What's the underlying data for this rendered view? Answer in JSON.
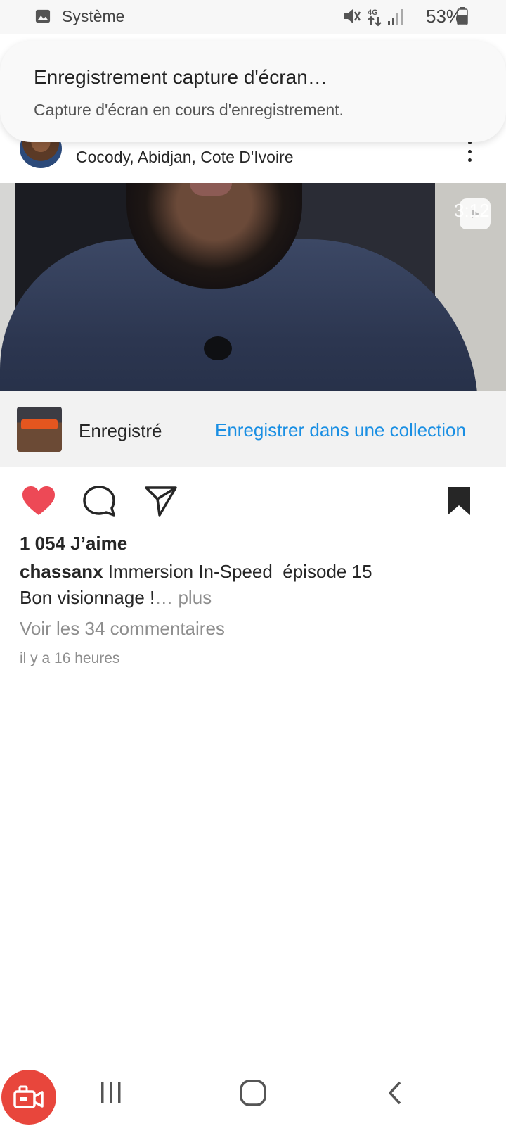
{
  "status_bar": {
    "notification_app_icon": "image-icon",
    "notification_app": "Système",
    "network": "4G",
    "battery_percent": "53%"
  },
  "notification": {
    "title": "Enregistrement capture d'écran…",
    "body": "Capture d'écran en cours d'enregistrement."
  },
  "post": {
    "author": "chassanx",
    "location": "Cocody, Abidjan, Cote D'Ivoire",
    "video_duration": "3:12",
    "saved_label": "Enregistré",
    "collection_link": "Enregistrer dans une collection",
    "likes": "1 054 J’aime",
    "caption_user": "chassanx",
    "caption_text": " Immersion In-Speed  épisode 15",
    "caption_line2": "Bon visionnage !",
    "more": "… plus",
    "comments_link": "Voir les 34 commentaires",
    "time_ago": "il y a 16 heures"
  },
  "colors": {
    "accent_link": "#1a8fe3",
    "like_red": "#ed4956",
    "recorder_red": "#e8463c"
  }
}
